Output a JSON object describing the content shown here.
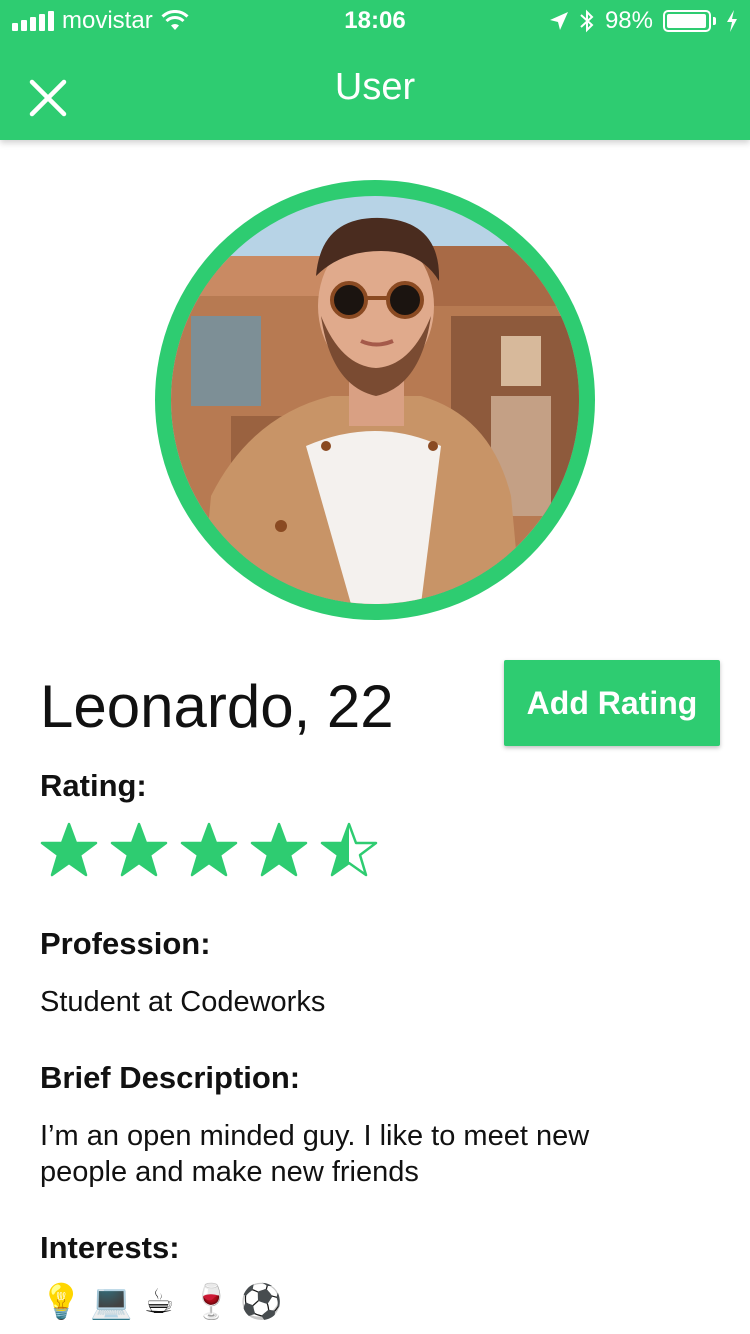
{
  "status_bar": {
    "carrier": "movistar",
    "time": "18:06",
    "battery_percent": "98%",
    "battery_level": 0.98,
    "icons": [
      "signal-icon",
      "wifi-icon",
      "location-arrow-icon",
      "bluetooth-icon",
      "battery-icon",
      "charging-bolt-icon"
    ]
  },
  "nav": {
    "title": "User",
    "close_icon": "close-icon"
  },
  "profile": {
    "name_age": "Leonardo, 22",
    "add_rating_label": "Add Rating",
    "rating_label": "Rating:",
    "rating_value": 4.5,
    "rating_max": 5,
    "profession_label": "Profession:",
    "profession": "Student at Codeworks",
    "description_label": "Brief Description:",
    "description": "I’m an open minded guy. I like to meet new people and make new friends",
    "interests_label": "Interests:",
    "interests": [
      "💡",
      "💻",
      "☕",
      "🍷",
      "⚽"
    ]
  },
  "colors": {
    "accent": "#2ecc71",
    "text": "#111111",
    "background": "#ffffff"
  }
}
